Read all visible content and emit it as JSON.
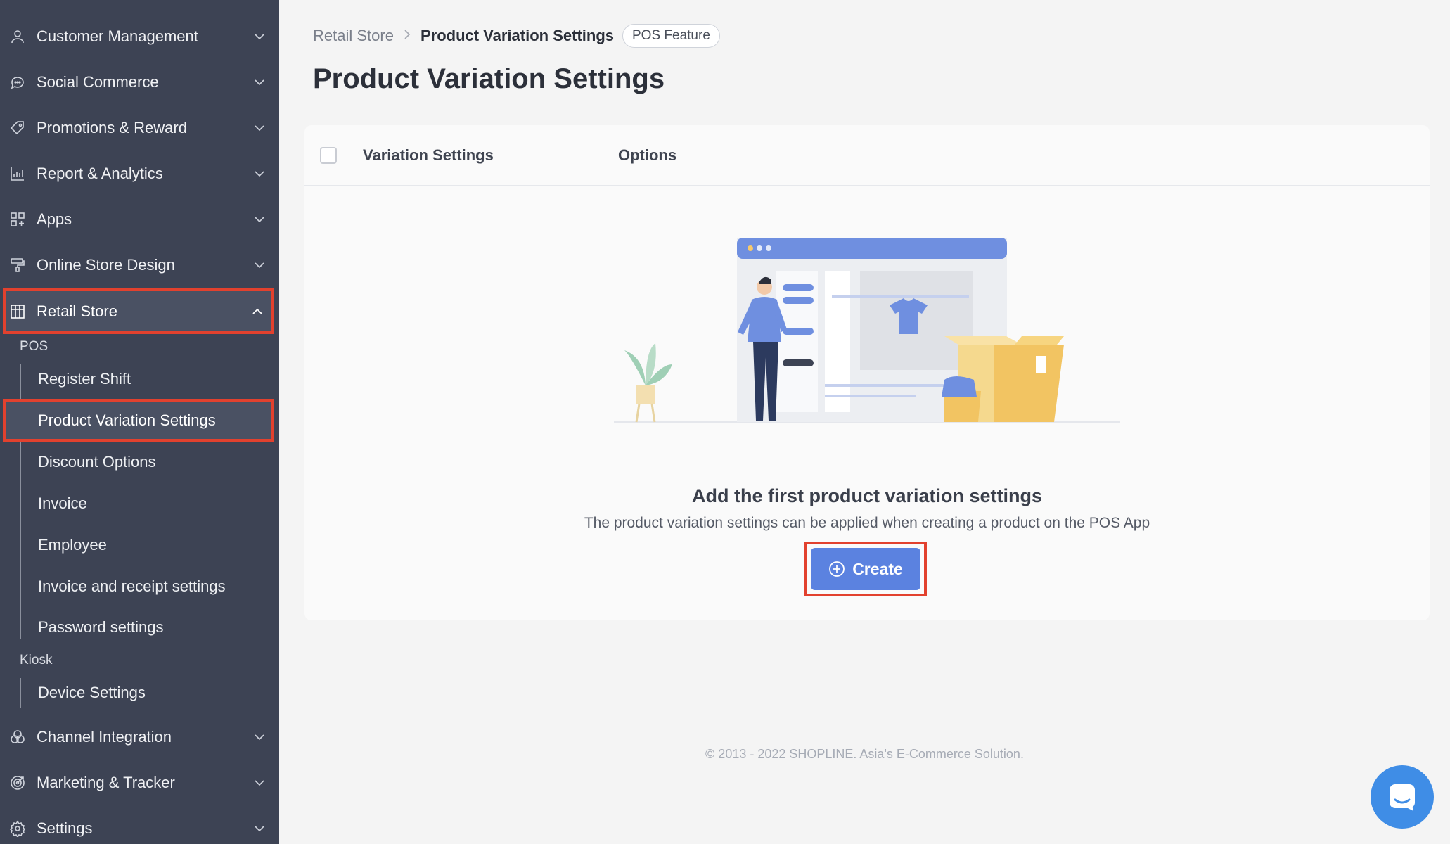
{
  "sidebar": {
    "items_top": [
      {
        "label": "Customer Management",
        "icon": "person-icon"
      },
      {
        "label": "Social Commerce",
        "icon": "chat-bubble-icon"
      },
      {
        "label": "Promotions & Reward",
        "icon": "tag-icon"
      },
      {
        "label": "Report & Analytics",
        "icon": "bar-chart-icon"
      },
      {
        "label": "Apps",
        "icon": "apps-grid-icon"
      },
      {
        "label": "Online Store Design",
        "icon": "paint-roller-icon"
      },
      {
        "label": "Retail Store",
        "icon": "store-icon"
      }
    ],
    "pos_label": "POS",
    "pos_items": [
      "Register Shift",
      "Product Variation Settings",
      "Discount Options",
      "Invoice",
      "Employee",
      "Invoice and receipt settings",
      "Password settings"
    ],
    "kiosk_label": "Kiosk",
    "kiosk_items": [
      "Device Settings"
    ],
    "items_bottom": [
      {
        "label": "Channel Integration",
        "icon": "channels-icon"
      },
      {
        "label": "Marketing & Tracker",
        "icon": "target-icon"
      },
      {
        "label": "Settings",
        "icon": "gear-icon"
      }
    ]
  },
  "breadcrumb": {
    "parent": "Retail Store",
    "separator": ">",
    "current": "Product Variation Settings",
    "badge": "POS Feature"
  },
  "page_title": "Product Variation Settings",
  "table": {
    "columns": [
      "Variation Settings",
      "Options"
    ]
  },
  "empty_state": {
    "title": "Add the first product variation settings",
    "description": "The product variation settings can be applied when creating a product on the POS App",
    "button_label": "Create"
  },
  "footer": "© 2013 - 2022 SHOPLINE. Asia's E-Commerce Solution.",
  "colors": {
    "sidebar_bg": "#3d4354",
    "accent": "#5b82e0",
    "highlight": "#e2412e",
    "chat": "#3f8de6"
  }
}
